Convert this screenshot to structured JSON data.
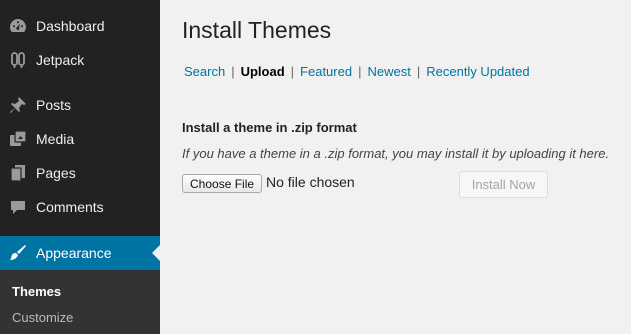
{
  "sidebar": {
    "items": [
      {
        "label": "Dashboard",
        "icon": "dashboard-icon"
      },
      {
        "label": "Jetpack",
        "icon": "jetpack-icon"
      },
      {
        "label": "Posts",
        "icon": "pin-icon"
      },
      {
        "label": "Media",
        "icon": "media-icon"
      },
      {
        "label": "Pages",
        "icon": "pages-icon"
      },
      {
        "label": "Comments",
        "icon": "comment-icon"
      },
      {
        "label": "Appearance",
        "icon": "paintbrush-icon",
        "active": true
      }
    ],
    "submenu": [
      {
        "label": "Themes",
        "current": true
      },
      {
        "label": "Customize"
      }
    ]
  },
  "main": {
    "title": "Install Themes",
    "subnav": [
      {
        "label": "Search"
      },
      {
        "label": "Upload",
        "current": true
      },
      {
        "label": "Featured"
      },
      {
        "label": "Newest"
      },
      {
        "label": "Recently Updated"
      }
    ],
    "section_heading": "Install a theme in .zip format",
    "section_desc": "If you have a theme in a .zip format, you may install it by uploading it here.",
    "choose_file_label": "Choose File",
    "no_file_text": "No file chosen",
    "install_button_label": "Install Now"
  },
  "colors": {
    "sidebar_bg": "#222222",
    "active_bg": "#0074a2",
    "link": "#0074a2",
    "page_bg": "#f1f1f1"
  }
}
